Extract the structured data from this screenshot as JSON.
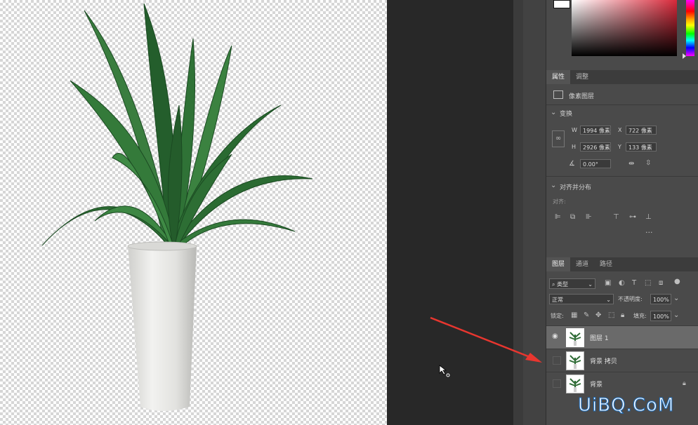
{
  "properties_panel": {
    "tabs": [
      {
        "label": "属性"
      },
      {
        "label": "调整"
      }
    ],
    "layer_kind": "像素图层",
    "transform": {
      "section_label": "变换",
      "w_label": "W",
      "w_value": "1994 像素",
      "h_label": "H",
      "h_value": "2926 像素",
      "x_label": "X",
      "x_value": "722 像素",
      "y_label": "Y",
      "y_value": "133 像素",
      "angle_value": "0.00°"
    },
    "align": {
      "section_label": "对齐并分布",
      "align_label": "对齐:",
      "more": "···"
    }
  },
  "layers_panel": {
    "tabs": [
      {
        "label": "图层"
      },
      {
        "label": "通道"
      },
      {
        "label": "路径"
      }
    ],
    "filter_kind": "类型",
    "blend_mode": "正常",
    "opacity_label": "不透明度:",
    "opacity_value": "100%",
    "lock_label": "锁定:",
    "fill_label": "填充:",
    "fill_value": "100%",
    "layers": [
      {
        "name": "图层 1",
        "visible": true,
        "selected": true,
        "locked": false
      },
      {
        "name": "背景 拷贝",
        "visible": false,
        "selected": false,
        "locked": false
      },
      {
        "name": "背景",
        "visible": false,
        "selected": false,
        "locked": true
      }
    ]
  },
  "watermark": "UiBQ.CoM",
  "colors": {
    "arrow": "#e8362f",
    "panel_bg": "#4a4a4a",
    "active_layer": "#6a6a6a"
  }
}
